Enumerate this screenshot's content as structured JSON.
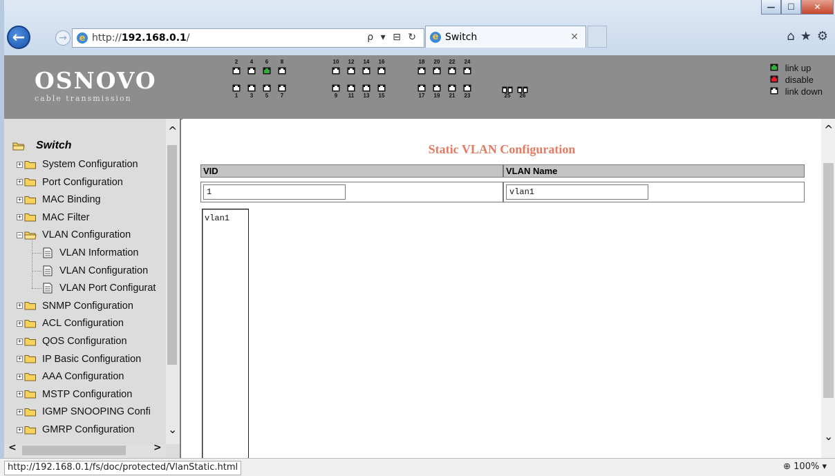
{
  "browser": {
    "url_prefix": "http://",
    "url_host": "192.168.0.1",
    "url_suffix": "/",
    "tab_title": "Switch",
    "tab_close": "×",
    "back_icon": "arrow-left-icon",
    "forward_icon": "arrow-right-icon",
    "address_actions": "ρ ▾ ⊟ ↻",
    "toolbar": {
      "home": "⌂",
      "favorites": "★",
      "settings": "⚙"
    },
    "window_buttons": {
      "minimize": "—",
      "maximize": "☐",
      "close": "✕"
    }
  },
  "header": {
    "logo": "OSNOVO",
    "logo_subtitle": "cable transmission",
    "ports_top": [
      "2",
      "4",
      "6",
      "8",
      "10",
      "12",
      "14",
      "16",
      "18",
      "20",
      "22",
      "24"
    ],
    "ports_bottom": [
      "1",
      "3",
      "5",
      "7",
      "9",
      "11",
      "13",
      "15",
      "17",
      "19",
      "21",
      "23"
    ],
    "ports_extra": [
      "25",
      "26"
    ],
    "port_status": {
      "6": "link up"
    },
    "legend": [
      {
        "label": "link up",
        "color": "#2fae3a"
      },
      {
        "label": "disable",
        "color": "#e0202a"
      },
      {
        "label": "link down",
        "color": "#ffffff"
      }
    ]
  },
  "sidebar": {
    "root": "Switch",
    "items": [
      {
        "label": "System Configuration",
        "expander": "+"
      },
      {
        "label": "Port Configuration",
        "expander": "+"
      },
      {
        "label": "MAC Binding",
        "expander": "+"
      },
      {
        "label": "MAC Filter",
        "expander": "+"
      },
      {
        "label": "VLAN Configuration",
        "expander": "−"
      },
      {
        "label": "VLAN Information",
        "child": true
      },
      {
        "label": "VLAN Configuration",
        "child": true
      },
      {
        "label": "VLAN Port Configurat",
        "child": true
      },
      {
        "label": "SNMP Configuration",
        "expander": "+"
      },
      {
        "label": "ACL Configuration",
        "expander": "+"
      },
      {
        "label": "QOS Configuration",
        "expander": "+"
      },
      {
        "label": "IP Basic Configuration",
        "expander": "+"
      },
      {
        "label": "AAA Configuration",
        "expander": "+"
      },
      {
        "label": "MSTP Configuration",
        "expander": "+"
      },
      {
        "label": "IGMP SNOOPING Confi",
        "expander": "+"
      },
      {
        "label": "GMRP Configuration",
        "expander": "+"
      }
    ]
  },
  "main": {
    "title": "Static VLAN Configuration",
    "columns": [
      "VID",
      "VLAN Name"
    ],
    "vid_value": "1",
    "vlan_name_value": "vlan1",
    "list_items": [
      "vlan1"
    ]
  },
  "status": {
    "url": "http://192.168.0.1/fs/doc/protected/VlanStatic.html",
    "zoom": "100%"
  },
  "colors": {
    "title": "#e57a63",
    "header_bg": "#8d8d8d",
    "sidebar_bg": "#dcdcdc",
    "link_up": "#2fae3a",
    "disable": "#e0202a"
  }
}
